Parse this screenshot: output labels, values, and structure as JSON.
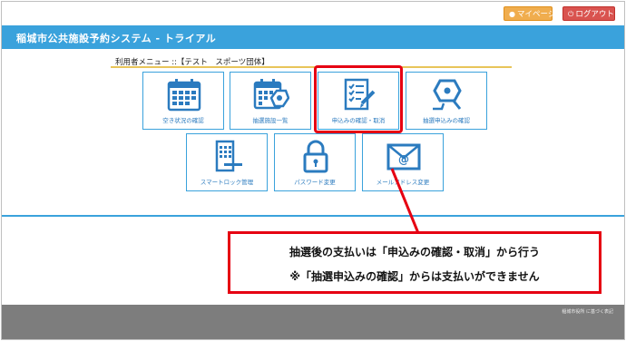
{
  "topbar": {
    "mypage_label": "マイページ",
    "logout_label": "ログアウト",
    "mypage_color": "#f0ad4e",
    "logout_color": "#d9534f"
  },
  "header": {
    "title": "稲城市公共施設予約システム - トライアル",
    "color": "#3aa2dc"
  },
  "menu": {
    "label": "利用者メニュー ::【テスト　スポーツ団体】",
    "tiles": [
      {
        "label": "空き状況の確認",
        "icon": "calendar-icon"
      },
      {
        "label": "抽選施設一覧",
        "icon": "calendar-lottery-icon"
      },
      {
        "label": "申込みの確認・取消",
        "icon": "checklist-pen-icon"
      },
      {
        "label": "抽選申込みの確認",
        "icon": "lottery-hand-icon"
      },
      {
        "label": "スマートロック管理",
        "icon": "smart-lock-door-icon"
      },
      {
        "label": "パスワード変更",
        "icon": "padlock-icon"
      },
      {
        "label": "メールアドレス変更",
        "icon": "email-icon"
      }
    ]
  },
  "callout": {
    "line1": "抽選後の支払いは「申込みの確認・取消」から行う",
    "line2": "※「抽選申込みの確認」からは支払いができません",
    "color": "#e60012"
  },
  "footer": {
    "text": "稲城市役所 に基づく表記"
  }
}
